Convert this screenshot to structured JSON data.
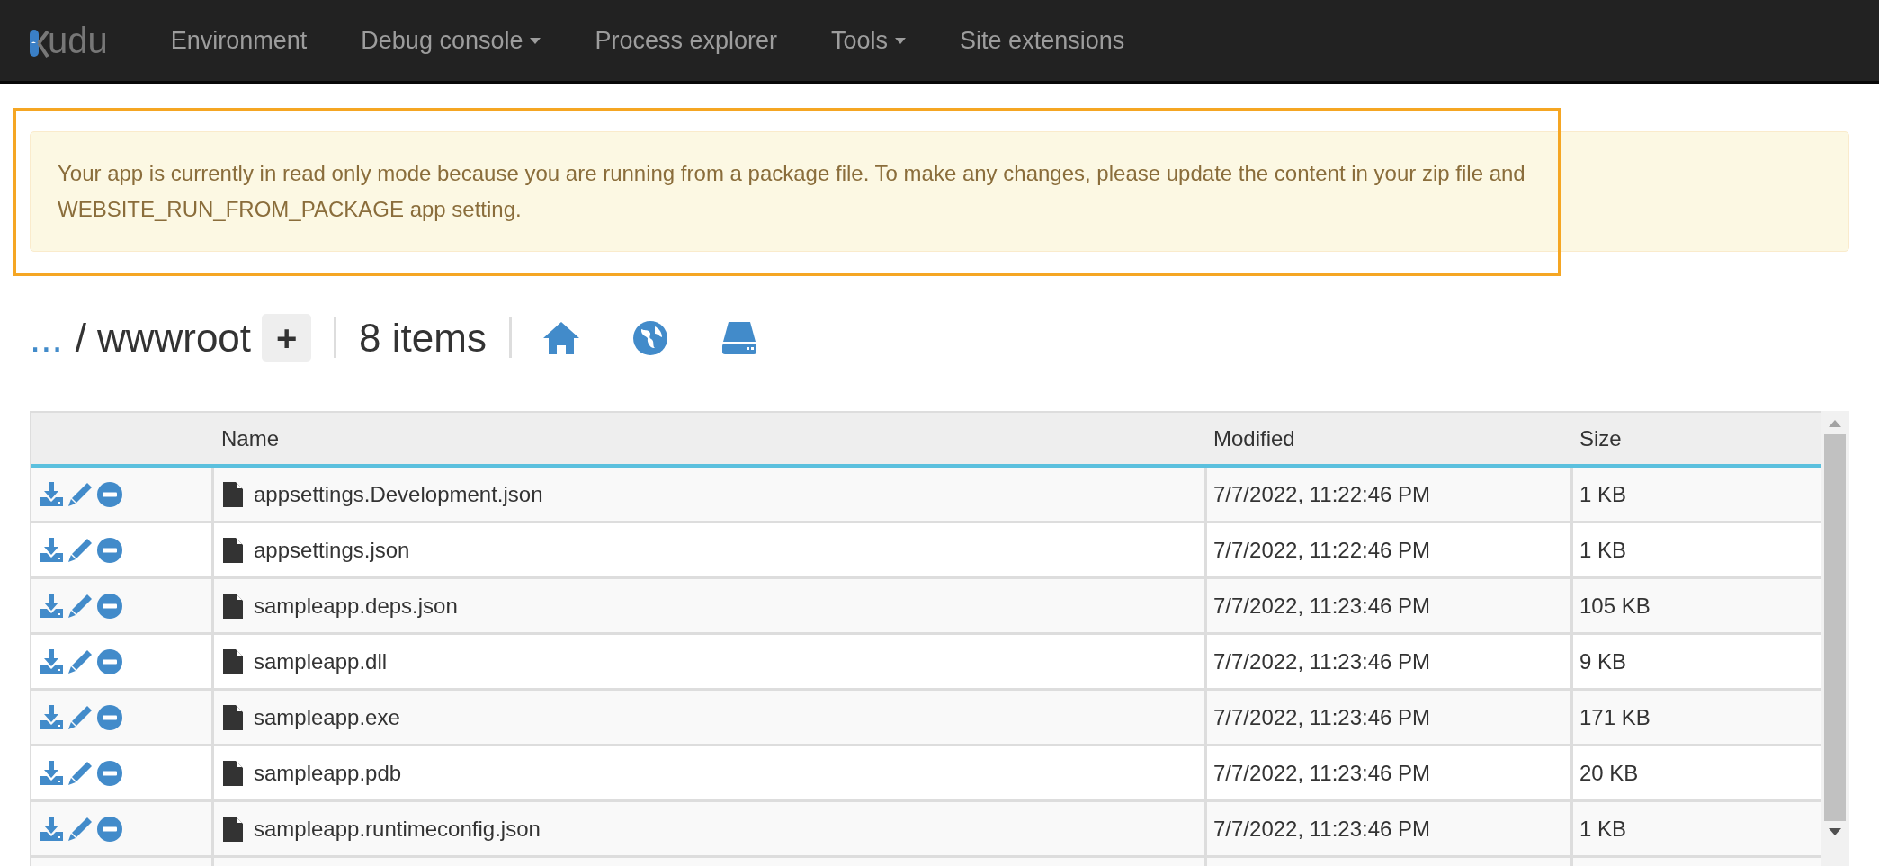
{
  "navbar": {
    "logo": "udu",
    "items": [
      {
        "label": "Environment",
        "dropdown": false
      },
      {
        "label": "Debug console",
        "dropdown": true
      },
      {
        "label": "Process explorer",
        "dropdown": false
      },
      {
        "label": "Tools",
        "dropdown": true
      },
      {
        "label": "Site extensions",
        "dropdown": false
      }
    ]
  },
  "alert": {
    "text": "Your app is currently in read only mode because you are running from a package file. To make any changes, please update the content in your zip file and WEBSITE_RUN_FROM_PACKAGE app setting.",
    "highlighted": true
  },
  "breadcrumb": {
    "parent": "...",
    "separator": "/",
    "folder": "wwwroot",
    "add_button": "+",
    "count": "8 items"
  },
  "table": {
    "columns": [
      "Name",
      "Modified",
      "Size"
    ],
    "rows": [
      {
        "name": "appsettings.Development.json",
        "modified": "7/7/2022, 11:22:46 PM",
        "size": "1 KB"
      },
      {
        "name": "appsettings.json",
        "modified": "7/7/2022, 11:22:46 PM",
        "size": "1 KB"
      },
      {
        "name": "sampleapp.deps.json",
        "modified": "7/7/2022, 11:23:46 PM",
        "size": "105 KB"
      },
      {
        "name": "sampleapp.dll",
        "modified": "7/7/2022, 11:23:46 PM",
        "size": "9 KB"
      },
      {
        "name": "sampleapp.exe",
        "modified": "7/7/2022, 11:23:46 PM",
        "size": "171 KB"
      },
      {
        "name": "sampleapp.pdb",
        "modified": "7/7/2022, 11:23:46 PM",
        "size": "20 KB"
      },
      {
        "name": "sampleapp.runtimeconfig.json",
        "modified": "7/7/2022, 11:23:46 PM",
        "size": "1 KB"
      }
    ]
  }
}
